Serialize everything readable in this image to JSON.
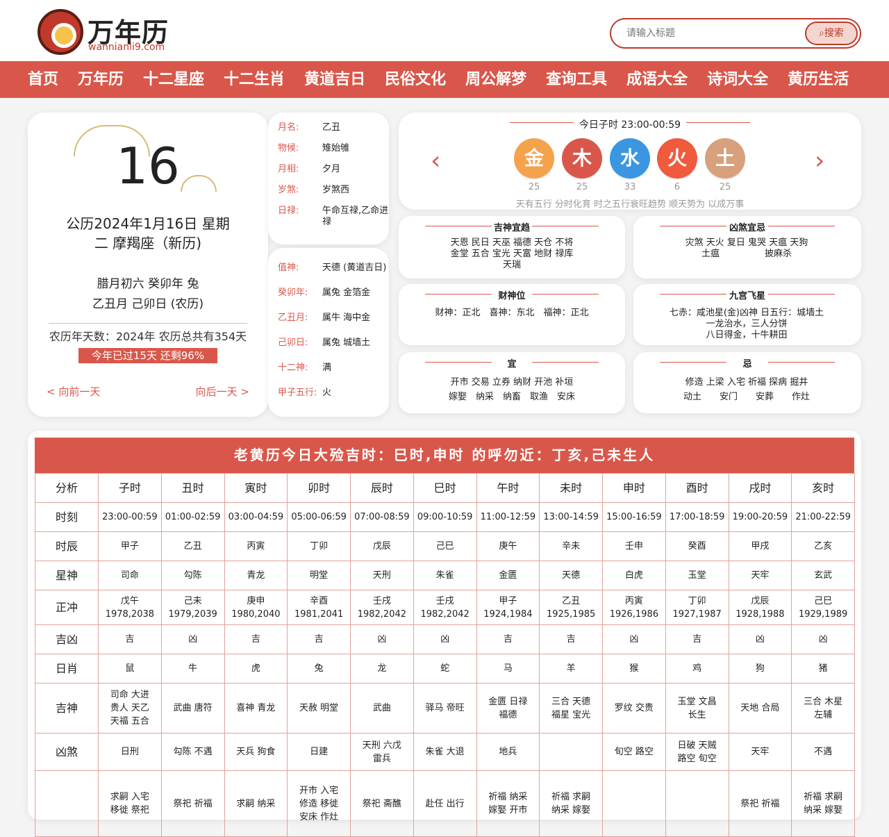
{
  "header": {
    "logo_title": "万年历",
    "logo_url": "wannianli9.com",
    "search_placeholder": "请输入标题",
    "search_button": "搜索"
  },
  "nav": [
    "首页",
    "万年历",
    "十二星座",
    "十二生肖",
    "黄道吉日",
    "民俗文化",
    "周公解梦",
    "查询工具",
    "成语大全",
    "诗词大全",
    "黄历生活"
  ],
  "date_card": {
    "day": "16",
    "gregorian": "公历2024年1月16日 星期二 摩羯座（新历)",
    "lunar": "腊月初六 癸卯年 兔\n乙丑月 己卯日 (农历)",
    "lunar_days": "农历年天数：2024年 农历总共有354天",
    "progress": "今年已过15天 还剩96%",
    "prev": "< 向前一天",
    "next": "向后一天 >"
  },
  "info1": [
    {
      "label": "月名:",
      "value": "乙丑"
    },
    {
      "label": "物候:",
      "value": "雉始雊"
    },
    {
      "label": "月相:",
      "value": "夕月"
    },
    {
      "label": "岁煞:",
      "value": "岁煞西"
    },
    {
      "label": "日禄:",
      "value": "午命互禄,乙命进禄"
    }
  ],
  "info2": [
    {
      "label": "值神:",
      "value": "天德 (黄道吉日)"
    },
    {
      "label": "癸卯年:",
      "value": "属兔 金箔金"
    },
    {
      "label": "乙丑月:",
      "value": "属牛 海中金"
    },
    {
      "label": "己卯日:",
      "value": "属兔 城墙土"
    },
    {
      "label": "十二神:",
      "value": "满"
    },
    {
      "label": "甲子五行:",
      "value": "火"
    }
  ],
  "five_elements": {
    "title": "今日子时 23:00-00:59",
    "items": [
      {
        "symbol": "金",
        "value": "25"
      },
      {
        "symbol": "木",
        "value": "25"
      },
      {
        "symbol": "水",
        "value": "33"
      },
      {
        "symbol": "火",
        "value": "6"
      },
      {
        "symbol": "土",
        "value": "25"
      }
    ],
    "note": "天有五行 分时化育 时之五行衰旺趋势 顺天势为 以成万事",
    "colors": [
      "#f5a24d",
      "#d9574a",
      "#3a96e0",
      "#f05a3d",
      "#d8a07c"
    ]
  },
  "cards": [
    {
      "title": "吉神宜趋",
      "body": "天恩 民日 天巫 福德 天仓 不将\n金堂 五合 宝光 天富 地财 禄库\n天瑞"
    },
    {
      "title": "凶煞宜忌",
      "body": "灾煞 天火 复日 鬼哭 天瘟 天狗\n土瘟　　　　　披麻杀"
    },
    {
      "title": "财神位",
      "body": "财神：正北　喜神：东北　福神：正北"
    },
    {
      "title": "九宫飞星",
      "body": "七赤：咸池星(金)凶神 日五行：城墙土\n一龙治水，三人分饼\n八日得金，十牛耕田"
    },
    {
      "title": "宜",
      "body": "开市 交易 立券 纳财 开池 补垣\n嫁娶　纳采　纳畜　取渔　安床"
    },
    {
      "title": "忌",
      "body": "修造 上梁 入宅 祈福 探病 掘井\n动土　　安门　　安葬　　作灶"
    }
  ],
  "bottom": {
    "title": "老黄历今日大殓吉时：巳时,申时 的呼勿近：丁亥,己未生人",
    "headers": [
      "分析",
      "子时",
      "丑时",
      "寅时",
      "卯时",
      "辰时",
      "巳时",
      "午时",
      "未时",
      "申时",
      "酉时",
      "戌时",
      "亥时"
    ],
    "rows": [
      [
        "时刻",
        "23:00-00:59",
        "01:00-02:59",
        "03:00-04:59",
        "05:00-06:59",
        "07:00-08:59",
        "09:00-10:59",
        "11:00-12:59",
        "13:00-14:59",
        "15:00-16:59",
        "17:00-18:59",
        "19:00-20:59",
        "21:00-22:59"
      ],
      [
        "时辰",
        "甲子",
        "乙丑",
        "丙寅",
        "丁卯",
        "戊辰",
        "己巳",
        "庚午",
        "辛未",
        "壬申",
        "癸酉",
        "甲戌",
        "乙亥"
      ],
      [
        "星神",
        "司命",
        "勾陈",
        "青龙",
        "明堂",
        "天刑",
        "朱雀",
        "金匮",
        "天德",
        "白虎",
        "玉堂",
        "天牢",
        "玄武"
      ],
      [
        "正冲",
        "戊午\n1978,2038",
        "己未\n1979,2039",
        "庚申\n1980,2040",
        "辛酉\n1981,2041",
        "壬戌\n1982,2042",
        "壬戌\n1982,2042",
        "甲子\n1924,1984",
        "乙丑\n1925,1985",
        "丙寅\n1926,1986",
        "丁卯\n1927,1987",
        "戊辰\n1928,1988",
        "己巳\n1929,1989"
      ],
      [
        "吉凶",
        "吉",
        "凶",
        "吉",
        "吉",
        "凶",
        "凶",
        "吉",
        "吉",
        "凶",
        "吉",
        "凶",
        "凶"
      ],
      [
        "日肖",
        "鼠",
        "牛",
        "虎",
        "兔",
        "龙",
        "蛇",
        "马",
        "羊",
        "猴",
        "鸡",
        "狗",
        "猪"
      ],
      [
        "吉神",
        "司命 大进\n贵人 天乙\n天福 五合",
        "武曲 唐符",
        "喜神 青龙",
        "天赦 明堂",
        "武曲",
        "驿马 帝旺",
        "金匮 日禄\n福德",
        "三合 天德\n福星 宝光",
        "罗纹 交贵",
        "玉堂 文昌\n长生",
        "天地 合局",
        "三合 木星\n左辅"
      ],
      [
        "凶煞",
        "日刑",
        "勾陈 不遇",
        "天兵 狗食",
        "日建",
        "天刑 六戊\n雷兵",
        "朱雀 大退",
        "地兵",
        "",
        "旬空 路空",
        "日破 天贼\n路空 旬空",
        "天牢",
        "不遇"
      ],
      [
        "",
        "求嗣 入宅\n移徙 祭祀",
        "祭祀 祈福",
        "求嗣 纳采",
        "开市 入宅\n修造 移徙\n安床 作灶",
        "祭祀 斋醮",
        "赴任 出行",
        "祈福 纳采\n嫁娶 开市",
        "祈福 求嗣\n纳采 嫁娶",
        "",
        "",
        "祭祀 祈福",
        "祈福 求嗣\n纳采 嫁娶"
      ]
    ]
  }
}
